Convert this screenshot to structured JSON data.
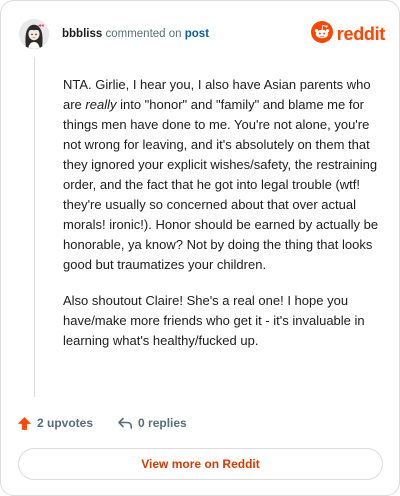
{
  "header": {
    "username": "bbbliss",
    "action_text": "commented on",
    "post_link": "post",
    "brand_name": "reddit",
    "brand_color": "#ff4500",
    "avatar_icon": "avatar-girl-icon",
    "brand_icon": "snoo-icon"
  },
  "comment": {
    "paragraph1_before": "NTA. Girlie, I hear you, I also have Asian parents who are ",
    "paragraph1_emphasis": "really",
    "paragraph1_after": " into \"honor\" and \"family\" and blame me for things men have done to me. You're not alone, you're not wrong for leaving, and it's absolutely on them that they ignored your explicit wishes/safety, the restraining order, and the fact that he got into legal trouble (wtf! they're usually so concerned about that over actual morals! ironic!). Honor should be earned by actually be honorable, ya know? Not by doing the thing that looks good but traumatizes your children.",
    "paragraph2": "Also shoutout Claire! She's a real one! I hope you have/make more friends who get it - it's invaluable in learning what's healthy/fucked up."
  },
  "actions": {
    "upvotes": "2 upvotes",
    "replies": "0 replies",
    "upvote_icon": "upvote-arrow-icon",
    "reply_icon": "reply-arrow-icon",
    "upvote_color": "#ff4500"
  },
  "footer": {
    "view_more_label": "View more on Reddit",
    "view_more_color": "#d93a00"
  }
}
